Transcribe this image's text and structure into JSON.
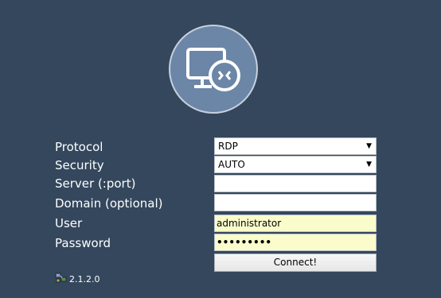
{
  "form": {
    "protocol": {
      "label": "Protocol",
      "value": "RDP"
    },
    "security": {
      "label": "Security",
      "value": "AUTO"
    },
    "server": {
      "label": "Server (:port)",
      "value": ""
    },
    "domain": {
      "label": "Domain (optional)",
      "value": ""
    },
    "user": {
      "label": "User",
      "value": "administrator"
    },
    "password": {
      "label": "Password",
      "masked_value": "•••••••••"
    },
    "connect_label": "Connect!"
  },
  "footer": {
    "version": "2.1.2.0",
    "icon": "network-icon"
  },
  "icons": {
    "logo": "remote-desktop-icon",
    "dropdown": "dropdown-arrow-icon"
  },
  "colors": {
    "background": "#34475d",
    "logo_circle": "#6c86a7",
    "autofill": "#fafccb"
  }
}
